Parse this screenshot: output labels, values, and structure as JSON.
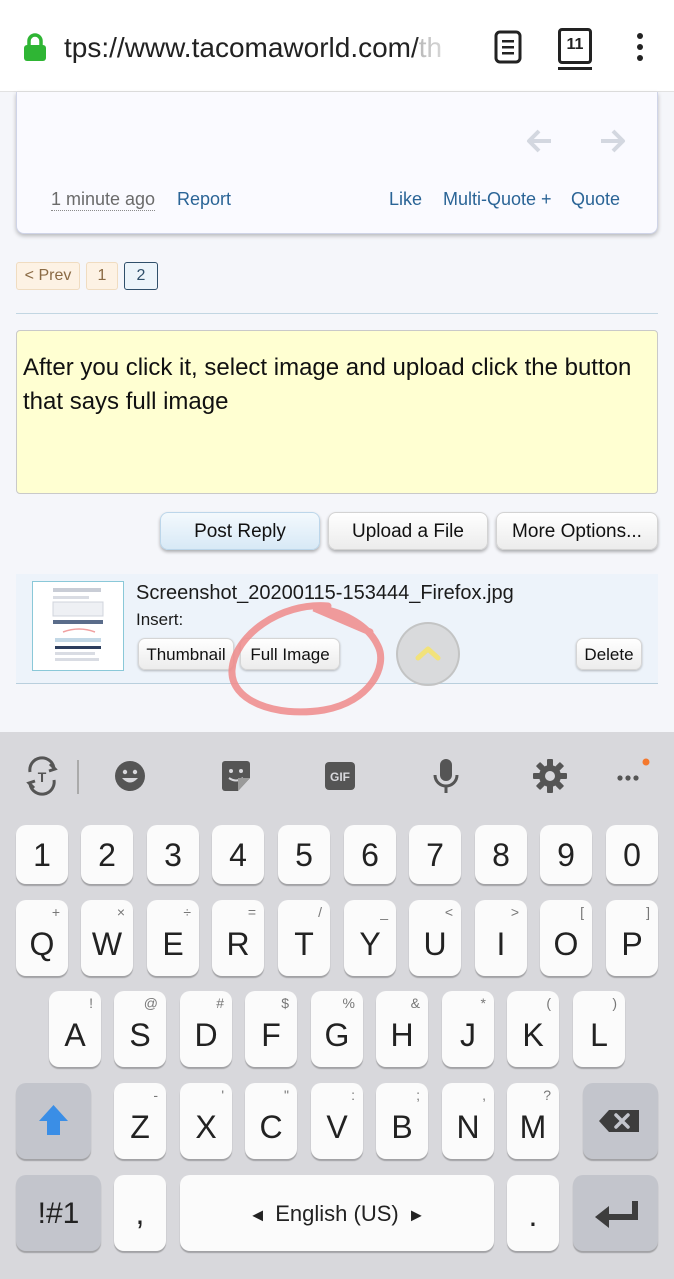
{
  "browser": {
    "url_visible": "tps://www.tacomaworld.com/",
    "url_faded": "th",
    "tab_count": "11"
  },
  "post": {
    "time": "1 minute ago",
    "report": "Report",
    "like": "Like",
    "multiquote": "Multi-Quote +",
    "quote": "Quote"
  },
  "pagination": {
    "prev": "< Prev",
    "pages": [
      "1",
      "2"
    ],
    "current": "2"
  },
  "editor": {
    "text": "After you click it, select image and upload click the button that says full image"
  },
  "actions": {
    "post_reply": "Post Reply",
    "upload": "Upload a File",
    "more": "More Options..."
  },
  "attachment": {
    "filename": "Screenshot_20200115-153444_Firefox.jpg",
    "insert_label": "Insert:",
    "thumbnail_btn": "Thumbnail",
    "full_image_btn": "Full Image",
    "delete_btn": "Delete"
  },
  "keyboard": {
    "numbers": [
      "1",
      "2",
      "3",
      "4",
      "5",
      "6",
      "7",
      "8",
      "9",
      "0"
    ],
    "row1": [
      {
        "m": "Q",
        "s": "+"
      },
      {
        "m": "W",
        "s": "×"
      },
      {
        "m": "E",
        "s": "÷"
      },
      {
        "m": "R",
        "s": "="
      },
      {
        "m": "T",
        "s": "/"
      },
      {
        "m": "Y",
        "s": "_"
      },
      {
        "m": "U",
        "s": "<"
      },
      {
        "m": "I",
        "s": ">"
      },
      {
        "m": "O",
        "s": "["
      },
      {
        "m": "P",
        "s": "]"
      }
    ],
    "row2": [
      {
        "m": "A",
        "s": "!"
      },
      {
        "m": "S",
        "s": "@"
      },
      {
        "m": "D",
        "s": "#"
      },
      {
        "m": "F",
        "s": "$"
      },
      {
        "m": "G",
        "s": "%"
      },
      {
        "m": "H",
        "s": "&"
      },
      {
        "m": "J",
        "s": "*"
      },
      {
        "m": "K",
        "s": "("
      },
      {
        "m": "L",
        "s": ")"
      }
    ],
    "row3": [
      {
        "m": "Z",
        "s": "-"
      },
      {
        "m": "X",
        "s": "'"
      },
      {
        "m": "C",
        "s": "\""
      },
      {
        "m": "V",
        "s": ":"
      },
      {
        "m": "B",
        "s": ";"
      },
      {
        "m": "N",
        "s": ","
      },
      {
        "m": "M",
        "s": "?"
      }
    ],
    "symbols_key": "!#1",
    "comma_key": ",",
    "space_label": "English (US)",
    "period_key": ".",
    "toolbar_icons": [
      "translate-icon",
      "emoji-icon",
      "sticker-icon",
      "gif-icon",
      "microphone-icon",
      "settings-icon",
      "more-icon"
    ],
    "gif_label": "GIF"
  },
  "colors": {
    "link": "#2a6496",
    "editor_bg": "#ffffd2",
    "shift_blue": "#3a8ee6",
    "annotation_red": "#ef8a8a"
  }
}
